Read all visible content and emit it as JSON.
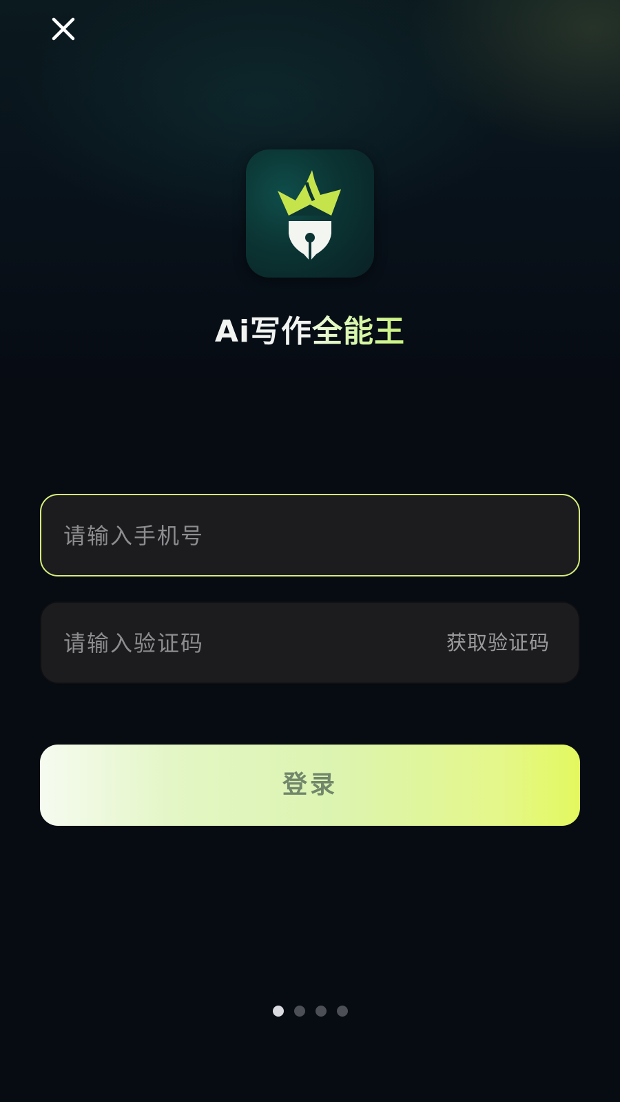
{
  "app": {
    "title_part1": "Ai写作",
    "title_part2": "全能王",
    "logo_icon": "crown-pen-nib-icon"
  },
  "header": {
    "close_icon": "close-icon"
  },
  "form": {
    "phone_placeholder": "请输入手机号",
    "phone_value": "",
    "code_placeholder": "请输入验证码",
    "code_value": "",
    "get_code_label": "获取验证码",
    "login_label": "登录"
  },
  "pager": {
    "count": 4,
    "active_index": 0
  },
  "colors": {
    "accent": "#d6ef7c",
    "background": "#070b12",
    "field_bg": "#1c1c1e",
    "login_text": "#71866b"
  }
}
